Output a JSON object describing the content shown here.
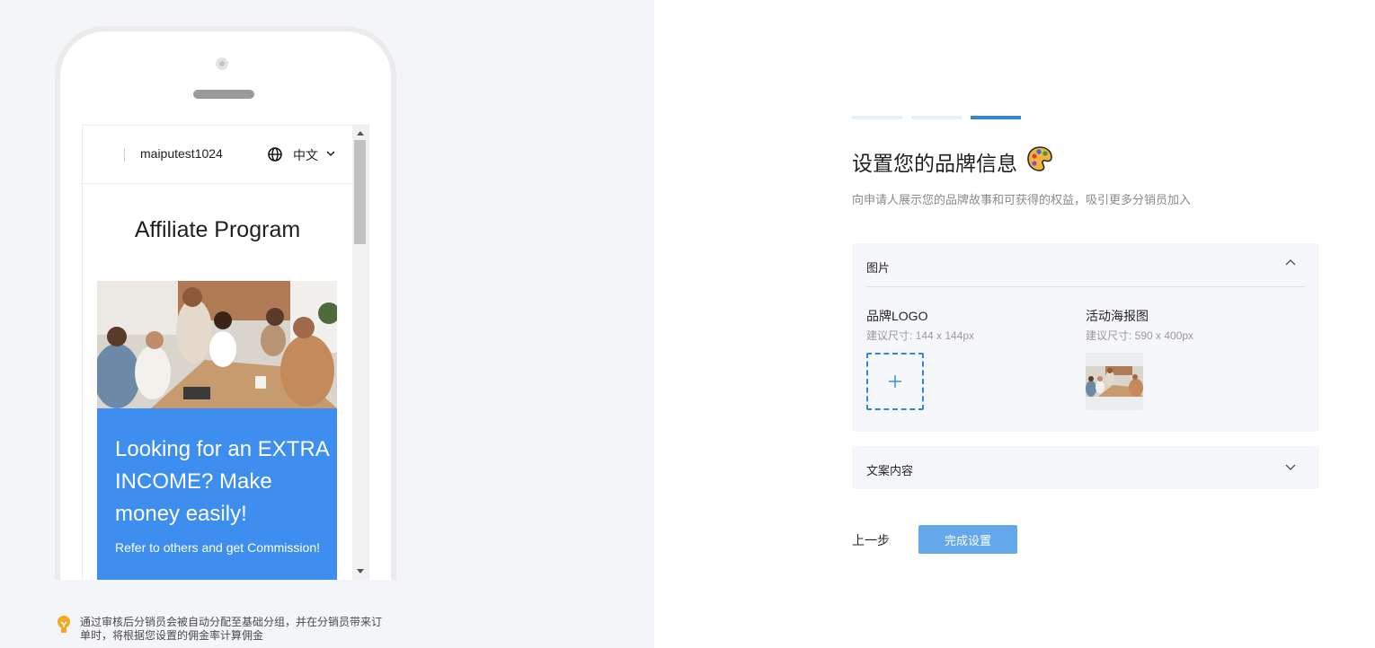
{
  "preview": {
    "store_name": "maiputest1024",
    "language": "中文",
    "program_title": "Affiliate Program",
    "hero_headline": "Looking for an EXTRA INCOME? Make money easily!",
    "hero_subtext": "Refer to others and get Commission!",
    "footer_note": "通过审核后分销员会被自动分配至基础分组，并在分销员带来订单时，将根据您设置的佣金率计算佣金"
  },
  "setup": {
    "steps": [
      {
        "state": "done"
      },
      {
        "state": "done"
      },
      {
        "state": "current"
      }
    ],
    "title": "设置您的品牌信息",
    "subtitle": "向申请人展示您的品牌故事和可获得的权益，吸引更多分销员加入",
    "images_section": {
      "title": "图片",
      "brand_logo_label": "品牌LOGO",
      "brand_logo_hint": "建议尺寸: 144 x 144px",
      "poster_label": "活动海报图",
      "poster_hint": "建议尺寸: 590 x 400px"
    },
    "copy_section": {
      "title": "文案内容"
    },
    "prev_label": "上一步",
    "finish_label": "完成设置"
  },
  "colors": {
    "accent": "#2e86de",
    "button_primary": "#62a8ea",
    "hero_card": "#3e8ef0",
    "panel_bg": "#f6f7fa",
    "left_bg": "#f3f5f8"
  },
  "icons": [
    "globe-icon",
    "chevron-down-icon",
    "chevron-up-icon",
    "plus-icon",
    "palette-icon",
    "lightbulb-icon"
  ]
}
